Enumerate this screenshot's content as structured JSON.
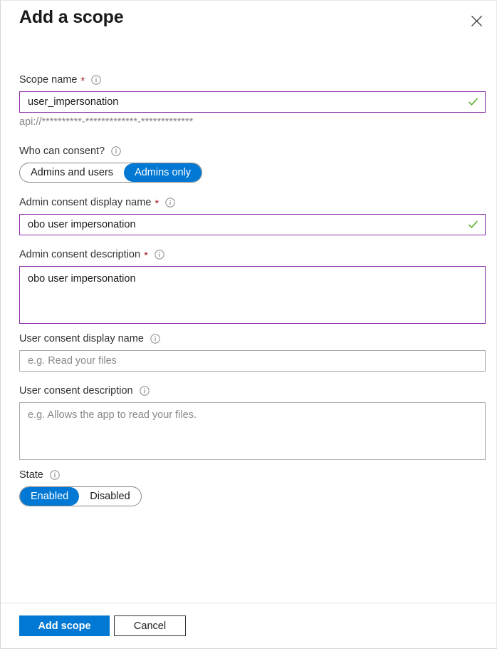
{
  "panel": {
    "title": "Add a scope",
    "close_icon": "close-icon"
  },
  "fields": {
    "scope_name": {
      "label": "Scope name",
      "required_marker": "*",
      "info_icon": "info-icon",
      "value": "user_impersonation",
      "placeholder": "",
      "validation_icon": "green-checkmark-icon",
      "helper_text": "api://**********-*************-*************"
    },
    "who_can_consent": {
      "label": "Who can consent?",
      "info_icon": "info-icon",
      "options": [
        {
          "label": "Admins and users",
          "selected": false
        },
        {
          "label": "Admins only",
          "selected": true
        }
      ]
    },
    "admin_consent_display_name": {
      "label": "Admin consent display name",
      "required_marker": "*",
      "info_icon": "info-icon",
      "value": "obo user impersonation",
      "placeholder": "",
      "validation_icon": "green-checkmark-icon"
    },
    "admin_consent_description": {
      "label": "Admin consent description",
      "required_marker": "*",
      "info_icon": "info-icon",
      "value": "obo user impersonation",
      "placeholder": ""
    },
    "user_consent_display_name": {
      "label": "User consent display name",
      "info_icon": "info-icon",
      "value": "",
      "placeholder": "e.g. Read your files"
    },
    "user_consent_description": {
      "label": "User consent description",
      "info_icon": "info-icon",
      "value": "",
      "placeholder": "e.g. Allows the app to read your files."
    },
    "state": {
      "label": "State",
      "info_icon": "info-icon",
      "options": [
        {
          "label": "Enabled",
          "selected": true
        },
        {
          "label": "Disabled",
          "selected": false
        }
      ]
    }
  },
  "footer": {
    "primary_label": "Add scope",
    "secondary_label": "Cancel"
  },
  "colors": {
    "accent_blue": "#0078d4",
    "valid_border_purple": "#8b2fa8",
    "required_red": "#a4262c",
    "success_green": "#5ab12a",
    "text_primary": "#1b1a19",
    "placeholder_grey": "#8a8886"
  }
}
